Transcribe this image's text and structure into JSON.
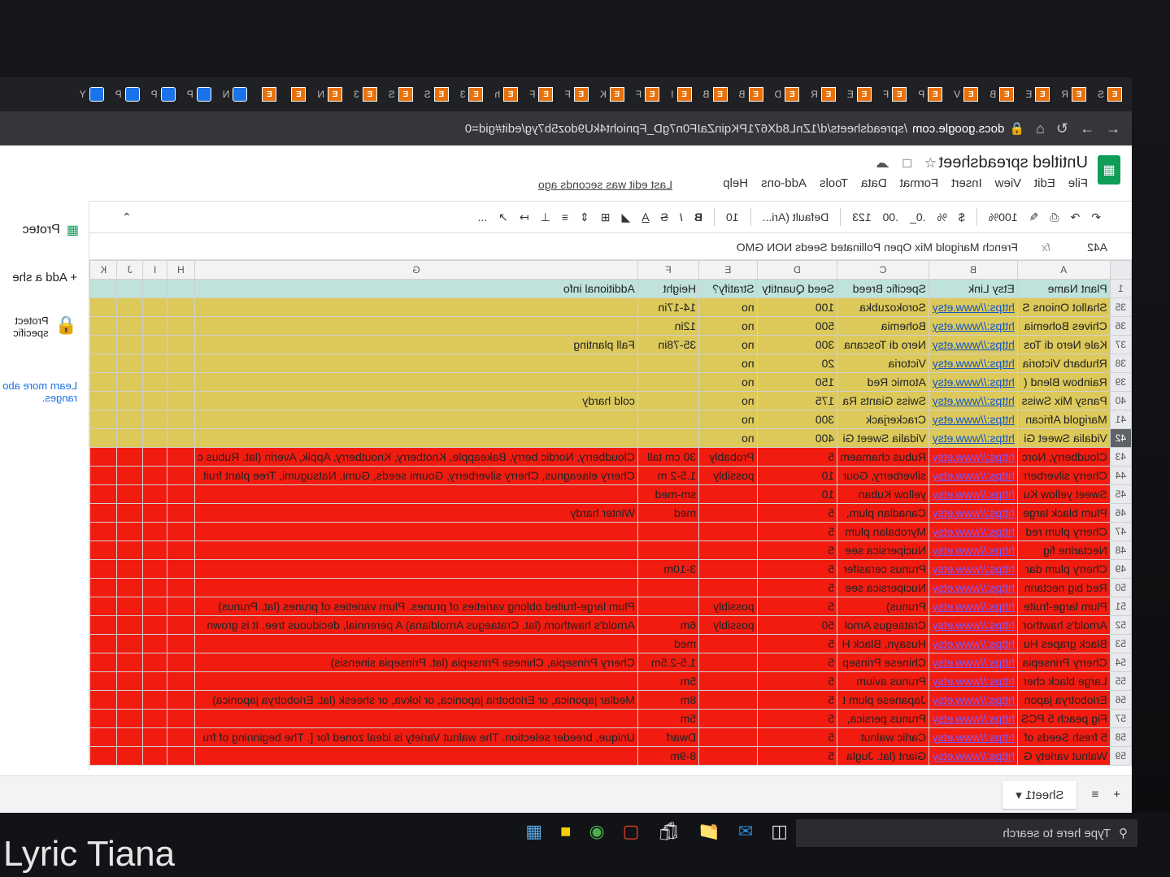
{
  "browser": {
    "tabs": [
      "S",
      "R",
      "E",
      "B",
      "V",
      "P",
      "F",
      "E",
      "R",
      "D",
      "B",
      "B",
      "I",
      "F",
      "K",
      "F",
      "F",
      "h",
      "3",
      "S",
      "S",
      "3",
      "N",
      "",
      ""
    ],
    "extra_tabs": [
      "N",
      "P",
      "P",
      "P",
      "Y"
    ],
    "url_domain": "docs.google.com",
    "url_path": "/spreadsheets/d/1ZnL8dX671PKqinZaIF0n7gD_Fpnioht4kU9doz5b7yg/edit#gid=0"
  },
  "app": {
    "title": "Untitled spreadsheet",
    "menus": [
      "File",
      "Edit",
      "View",
      "Insert",
      "Format",
      "Data",
      "Tools",
      "Add-ons",
      "Help"
    ],
    "last_edit": "Last edit was seconds ago",
    "toolbar": {
      "zoom": "100%",
      "currency": "$",
      "percent": "%",
      "dec_less": ".0_",
      "dec_more": ".00",
      "format": "123",
      "font": "Default (Ari...",
      "size": "10",
      "bold": "B",
      "italic": "I",
      "strike": "S",
      "text_color": "A",
      "more": "..."
    },
    "formula": {
      "cellref": "A42",
      "value": "French Marigold Mix Open Pollinated Seeds NON GMO"
    }
  },
  "grid": {
    "columns": [
      "A",
      "B",
      "C",
      "D",
      "E",
      "F",
      "G",
      "H",
      "I",
      "J",
      "K"
    ],
    "header_row": [
      "Plant Name",
      "Etsy Link",
      "Specific Breed",
      "Seed Quantity",
      "Stratify?",
      "Height",
      "Additional info",
      "",
      "",
      "",
      ""
    ],
    "rows": [
      {
        "n": "35",
        "style": "yellow",
        "cells": [
          "Shallot Onions S",
          "https://www.etsy",
          "Sorokozubka",
          "100",
          "no",
          "14-17in",
          "",
          "",
          "",
          "",
          ""
        ]
      },
      {
        "n": "36",
        "style": "yellow",
        "cells": [
          "Chives Bohemia",
          "https://www.etsy",
          "Bohemia",
          "500",
          "no",
          "12in",
          "",
          "",
          "",
          "",
          ""
        ]
      },
      {
        "n": "37",
        "style": "yellow",
        "cells": [
          "Kale Nero di Tos",
          "https://www.etsy",
          "Nero di Toscana",
          "300",
          "no",
          "35-78in",
          "Fall planting",
          "",
          "",
          "",
          ""
        ]
      },
      {
        "n": "38",
        "style": "yellow",
        "cells": [
          "Rhubarb Victoria",
          "https://www.etsy",
          "Victoria",
          "20",
          "no",
          "",
          "",
          "",
          "",
          "",
          ""
        ]
      },
      {
        "n": "39",
        "style": "yellow",
        "cells": [
          "Rainbow Blend (",
          "https://www.etsy",
          "Atomic Red",
          "150",
          "no",
          "",
          "",
          "",
          "",
          "",
          ""
        ]
      },
      {
        "n": "40",
        "style": "yellow",
        "cells": [
          "Pansy Mix Swiss",
          "https://www.etsy",
          "Swiss Giants Ra",
          "175",
          "no",
          "",
          "cold hardy",
          "",
          "",
          "",
          ""
        ]
      },
      {
        "n": "41",
        "style": "yellow",
        "cells": [
          "Marigold African",
          "https://www.etsy",
          "Crackerjack",
          "300",
          "no",
          "",
          "",
          "",
          "",
          "",
          ""
        ]
      },
      {
        "n": "42",
        "style": "yellow",
        "cells": [
          "Vidalia Sweet Gi",
          "https://www.etsy",
          "Vidalia Sweet Gi",
          "400",
          "no",
          "",
          "",
          "",
          "",
          "",
          ""
        ]
      },
      {
        "n": "43",
        "style": "red",
        "cells": [
          "Cloudberry, Norc",
          "https://www.etsy",
          "Rubus chamaem",
          "5",
          "Probably",
          "30 cm tall",
          "Cloudberry, Nordic berry, Bakeapple, Knotberry, Knoutberry, Appik, Averin (lat. Rubus c",
          "",
          "",
          "",
          ""
        ]
      },
      {
        "n": "44",
        "style": "red",
        "cells": [
          "Cherry silverberr",
          "https://www.etsy",
          "silverberry, Gour",
          "10",
          "possibly",
          "1.5-2 m",
          "Cherry elaeagnus, Cherry silverberry, Goumi seeds, Gumi, Natsugumi, Tree plant fruit",
          "",
          "",
          "",
          ""
        ]
      },
      {
        "n": "45",
        "style": "red",
        "cells": [
          "Sweet yellow Ku",
          "https://www.etsy",
          "yellow Kuban",
          "10",
          "",
          "sm-med",
          "",
          "",
          "",
          "",
          ""
        ]
      },
      {
        "n": "46",
        "style": "red",
        "cells": [
          "Plum black large",
          "https://www.etsy",
          "Canadian plum,",
          "5",
          "",
          "med",
          "Winter hardy",
          "",
          "",
          "",
          ""
        ]
      },
      {
        "n": "47",
        "style": "red",
        "cells": [
          "Cherry plum red",
          "https://www.etsy",
          "Myrobalan plum",
          "5",
          "",
          "",
          "",
          "",
          "",
          "",
          ""
        ]
      },
      {
        "n": "48",
        "style": "red",
        "cells": [
          "Nectarine fig",
          "https://www.etsy",
          "Nucipersica see",
          "5",
          "",
          "",
          "",
          "",
          "",
          "",
          ""
        ]
      },
      {
        "n": "49",
        "style": "red",
        "cells": [
          "Cherry plum dar",
          "https://www.etsy",
          "Prunus cerasifer",
          "5",
          "",
          "3-10m",
          "",
          "",
          "",
          "",
          ""
        ]
      },
      {
        "n": "50",
        "style": "red",
        "cells": [
          "Red big nectarin",
          "https://www.etsy",
          "Nucipersica see",
          "5",
          "",
          "",
          "",
          "",
          "",
          "",
          ""
        ]
      },
      {
        "n": "51",
        "style": "red",
        "cells": [
          "Plum large-fruite",
          "https://www.etsy",
          "Prunus)",
          "5",
          "possibly",
          "",
          "Plum large-fruited oblong varieties of prunes. Plum varieties of prunes (lat. Prunus)",
          "",
          "",
          "",
          ""
        ]
      },
      {
        "n": "52",
        "style": "red",
        "cells": [
          "Arnold's hawthor",
          "https://www.etsy",
          "Crataegus Arnol",
          "50",
          "possibly",
          "6m",
          "Arnold's hawthorn (lat. Crataegus Arnoldiana) A perennial, deciduous tree. It is grown",
          "",
          "",
          "",
          ""
        ]
      },
      {
        "n": "53",
        "style": "red",
        "cells": [
          "Black grapes Hu",
          "https://www.etsy",
          "Husayn, Black H",
          "5",
          "",
          "med",
          "",
          "",
          "",
          "",
          ""
        ]
      },
      {
        "n": "54",
        "style": "red",
        "cells": [
          "Cherry Prinsepia",
          "https://www.etsy",
          "Chinese Prinsep",
          "5",
          "",
          "1.5-2.5m",
          "Cherry Prinsepia, Chinese Prinsepia (lat. Prinsepia sinensis)",
          "",
          "",
          "",
          ""
        ]
      },
      {
        "n": "55",
        "style": "red",
        "cells": [
          "Large black cher",
          "https://www.etsy",
          "Prunus avium",
          "5",
          "",
          "5m",
          "",
          "",
          "",
          "",
          ""
        ]
      },
      {
        "n": "56",
        "style": "red",
        "cells": [
          "Eriobotrya japon",
          "https://www.etsy",
          "Japanese plum t",
          "5",
          "",
          "8m",
          "Medlar japonica, or Eriobotria japonica, or lokva, or sheesk (lat. Eriobotrya japonica)",
          "",
          "",
          "",
          ""
        ]
      },
      {
        "n": "57",
        "style": "red",
        "cells": [
          "Fig peach 5 PCS",
          "https://www.etsy",
          "Prunus persica,",
          "5",
          "",
          "5m",
          "",
          "",
          "",
          "",
          ""
        ]
      },
      {
        "n": "58",
        "style": "red",
        "cells": [
          "5 fresh Seeds of",
          "https://www.etsy",
          "Carlic walnut",
          "5",
          "",
          "Dwarf",
          "Unique, breeder selection. The walnut Variety is ideal zoned for [. The beginning of fru",
          "",
          "",
          "",
          ""
        ]
      },
      {
        "n": "59",
        "style": "red",
        "cells": [
          "Walnut variety G",
          "https://www.etsy",
          "Giant (lat. Jugla",
          "5",
          "",
          "8-9m",
          "",
          "",
          "",
          "",
          ""
        ]
      }
    ]
  },
  "side_panel": {
    "title": "Protec",
    "add": "Add a she",
    "protect": "Protect specific",
    "learn": "Learn more abo ranges."
  },
  "bottom": {
    "add": "+",
    "sheet": "Sheet1"
  },
  "taskbar": {
    "search_placeholder": "Type here to search"
  },
  "watermark": "Lyric Tiana"
}
